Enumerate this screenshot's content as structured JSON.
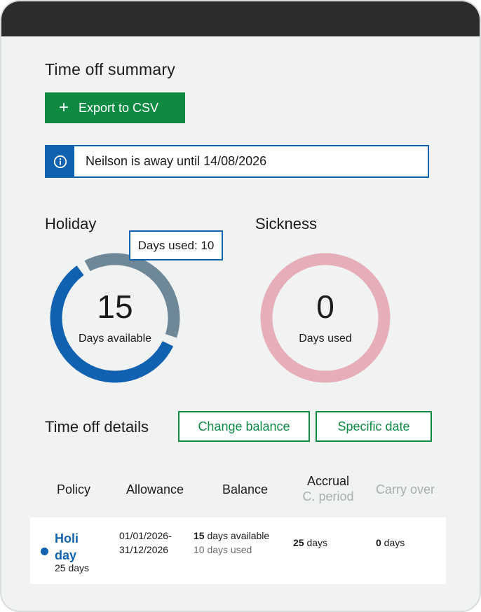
{
  "summary": {
    "title": "Time off summary",
    "export_label": "Export to CSV",
    "notice_text": "Neilson is away until 14/08/2026"
  },
  "holiday": {
    "label": "Holiday",
    "available": "15",
    "available_caption": "Days available",
    "tooltip": "Days used: 10",
    "used_fraction": 0.4,
    "color_available": "#1062b0",
    "color_used": "#6f8898"
  },
  "sickness": {
    "label": "Sickness",
    "used": "0",
    "caption": "Days used",
    "color": "#e6aeb8"
  },
  "details": {
    "title": "Time off details",
    "change_balance_label": "Change balance",
    "specific_date_label": "Specific date"
  },
  "table": {
    "headers": {
      "policy": "Policy",
      "allowance": "Allowance",
      "balance": "Balance",
      "accrual": "Accrual",
      "accrual_sub": "C. period",
      "carry_over": "Carry over"
    },
    "rows": [
      {
        "policy_name": "Holi day",
        "policy_days": "25 days",
        "allowance_start": "01/01/2026-",
        "allowance_end": "31/12/2026",
        "balance_available_num": "15",
        "balance_available_text": " days available",
        "balance_used": "10 days used",
        "accrual_num": "25",
        "accrual_text": " days",
        "carry_num": "0",
        "carry_text": " days"
      }
    ]
  },
  "colors": {
    "accent_green": "#0e8a42",
    "accent_blue": "#1062b0",
    "background": "#f1f3f3"
  }
}
